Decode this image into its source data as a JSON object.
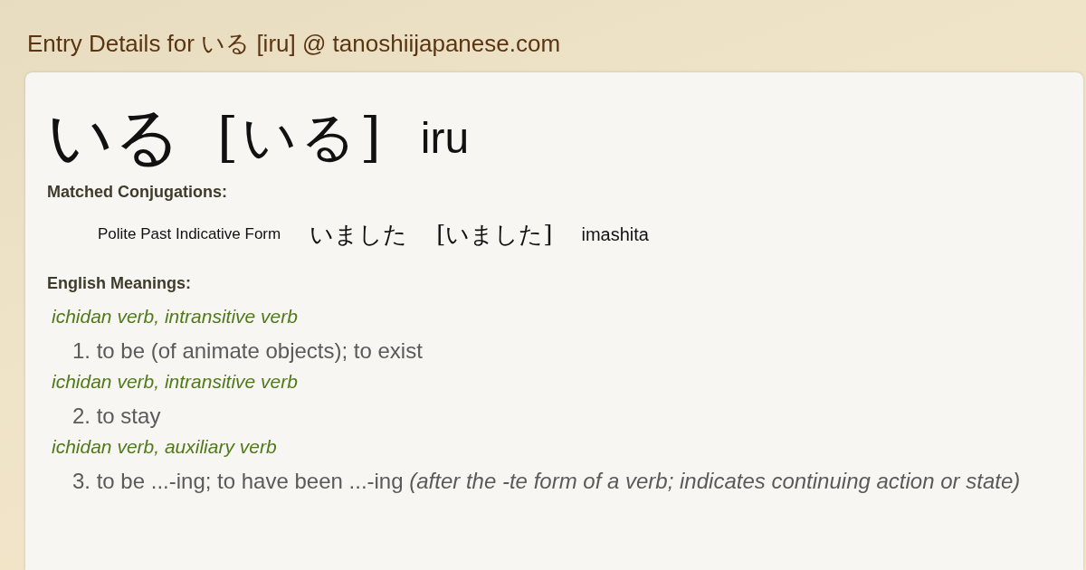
{
  "page_title": "Entry Details for いる [iru] @ tanoshiijapanese.com",
  "entry": {
    "word": "いる",
    "reading": "[いる]",
    "romaji": "iru"
  },
  "conjugations": {
    "heading": "Matched Conjugations:",
    "items": [
      {
        "form": "Polite Past Indicative Form",
        "word": "いました",
        "reading": "[いました]",
        "romaji": "imashita"
      }
    ]
  },
  "meanings": {
    "heading": "English Meanings:",
    "items": [
      {
        "pos": "ichidan verb, intransitive verb",
        "definition": "1. to be (of animate objects); to exist"
      },
      {
        "pos": "ichidan verb, intransitive verb",
        "definition": "2. to stay"
      },
      {
        "pos": "ichidan verb, auxiliary verb",
        "definition": "3. to be ...-ing; to have been ...-ing *(after the -te form of a verb; indicates continuing action or state)*"
      }
    ]
  }
}
